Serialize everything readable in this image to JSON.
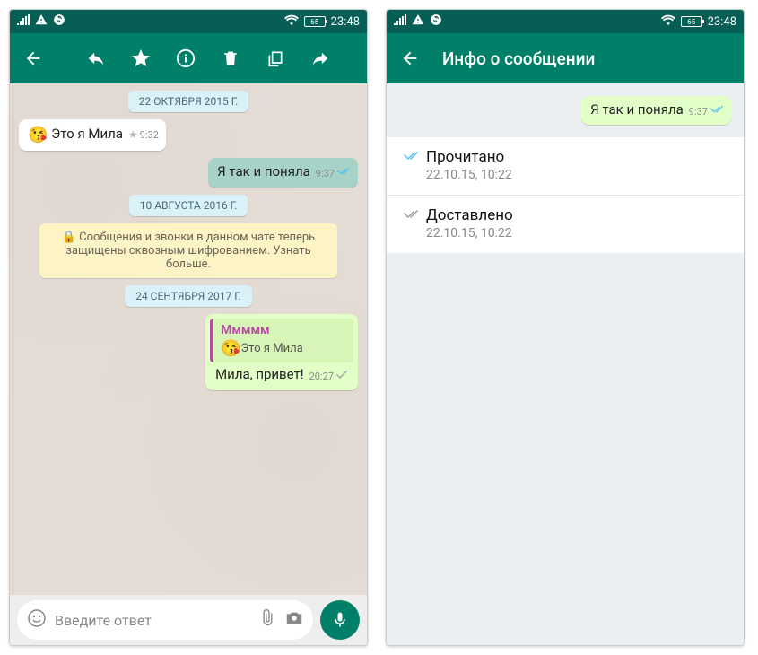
{
  "statusbar": {
    "battery": "65",
    "time": "23:48"
  },
  "chat": {
    "dates": {
      "d1": "22 ОКТЯБРЯ 2015 Г.",
      "d2": "10 АВГУСТА 2016 Г.",
      "d3": "24 СЕНТЯБРЯ 2017 Г."
    },
    "msg1": {
      "text": "Это я Мила",
      "time": "9:32"
    },
    "msg2": {
      "text": "Я так и поняла",
      "time": "9:37"
    },
    "encryption": "🔒 Сообщения и звонки в данном чате теперь защищены сквозным шифрованием. Узнать больше.",
    "msg3": {
      "quote_name": "Ммммм",
      "quote_text": "Это я Мила",
      "text": "Мила, привет!",
      "time": "20:27"
    },
    "input_placeholder": "Введите ответ"
  },
  "info": {
    "title": "Инфо о сообщении",
    "msg": {
      "text": "Я так и поняла",
      "time": "9:37"
    },
    "read": {
      "label": "Прочитано",
      "time": "22.10.15, 10:22"
    },
    "delivered": {
      "label": "Доставлено",
      "time": "22.10.15, 10:22"
    }
  }
}
